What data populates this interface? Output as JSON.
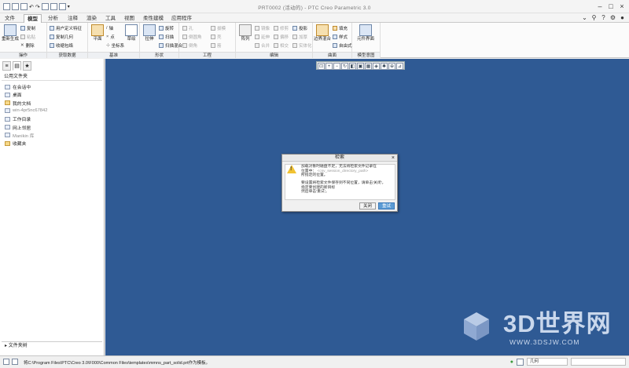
{
  "window": {
    "title": "PRT0002 (活动的) - PTC Creo Parametric 3.0"
  },
  "menubar": {
    "tabs": [
      "文件",
      "模型",
      "分析",
      "注释",
      "渲染",
      "工具",
      "视图",
      "柔性建模",
      "应用程序"
    ],
    "active": "模型"
  },
  "ribbon": {
    "groups": {
      "operations": {
        "label": "操作",
        "regenerate": "重新生成",
        "copy": "复制",
        "paste": "粘贴",
        "delete": "删除"
      },
      "get_data": {
        "label": "获取数据",
        "user_feature": "用户定义特征",
        "copy_geometry": "复制几何",
        "shrinkwrap": "收缩包络"
      },
      "datum": {
        "label": "基准",
        "plane": "平面",
        "axis": "轴",
        "point": "点",
        "coord_sys": "坐标系",
        "sketch": "草绘"
      },
      "shapes": {
        "label": "形状",
        "extrude": "拉伸",
        "revolve": "旋转",
        "sweep": "扫描",
        "swept_blend": "扫描混合"
      },
      "engineering": {
        "label": "工程",
        "hole": "孔",
        "round": "倒圆角",
        "chamfer": "倒角",
        "draft": "拔模",
        "shell": "壳",
        "rib": "筋"
      },
      "editing": {
        "label": "编辑",
        "pattern": "阵列",
        "mirror": "镜像",
        "extend": "延伸",
        "trim": "修剪",
        "offset": "偏移",
        "merge": "合并",
        "intersect": "相交",
        "project": "投影",
        "thicken": "加厚",
        "solidify": "实体化"
      },
      "surfaces": {
        "label": "曲面",
        "boundary_blend": "边界混合",
        "fill": "填充",
        "style": "样式",
        "freestyle": "自由式"
      },
      "model_intent": {
        "label": "模型意图",
        "component_interface": "元件界面"
      }
    }
  },
  "navigator": {
    "title": "公用文件夹",
    "folders": [
      {
        "label": "在会话中",
        "dim": false
      },
      {
        "label": "桌面",
        "dim": false
      },
      {
        "label": "我的文档",
        "dim": false
      },
      {
        "label": "win-4pr5nc67842",
        "dim": true
      },
      {
        "label": "工作目录",
        "dim": false
      },
      {
        "label": "网上邻居",
        "dim": false
      },
      {
        "label": "Manikin 库",
        "dim": true
      },
      {
        "label": "收藏夹",
        "dim": false
      }
    ],
    "browser_label": "文件夹树"
  },
  "dialog": {
    "title": "检索",
    "message_lines": [
      "加载对象时磁盘不足，无法将检索文件记录在",
      "位置中：",
      "所指定的位置。"
    ],
    "path": "<csv_session_directory_path>",
    "message_lines_2": [
      "要设置将检索文件保存到不同位置，请单击'关闭'，",
      "指定要创建的新目标",
      "然后单击'重试'。"
    ],
    "close_button": "关闭",
    "retry_button": "重试"
  },
  "status": {
    "text": "将C:\\Program Files\\PTC\\Creo 3.0\\F000\\Common Files\\templates\\mmns_part_solid.prt作为模板。",
    "selection": "几何"
  },
  "watermark": {
    "brand": "3D世界网",
    "url": "WWW.3DSJW.COM"
  }
}
